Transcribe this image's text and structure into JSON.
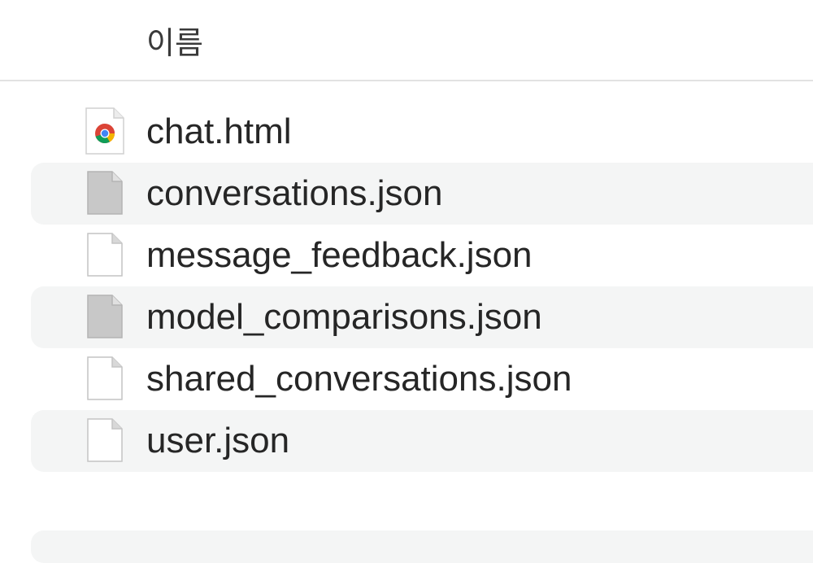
{
  "header": {
    "column_name": "이름"
  },
  "files": [
    {
      "name": "chat.html",
      "icon": "chrome-html-file-icon"
    },
    {
      "name": "conversations.json",
      "icon": "gray-document-icon"
    },
    {
      "name": "message_feedback.json",
      "icon": "document-icon"
    },
    {
      "name": "model_comparisons.json",
      "icon": "gray-document-icon"
    },
    {
      "name": "shared_conversations.json",
      "icon": "document-icon"
    },
    {
      "name": "user.json",
      "icon": "document-icon"
    }
  ]
}
